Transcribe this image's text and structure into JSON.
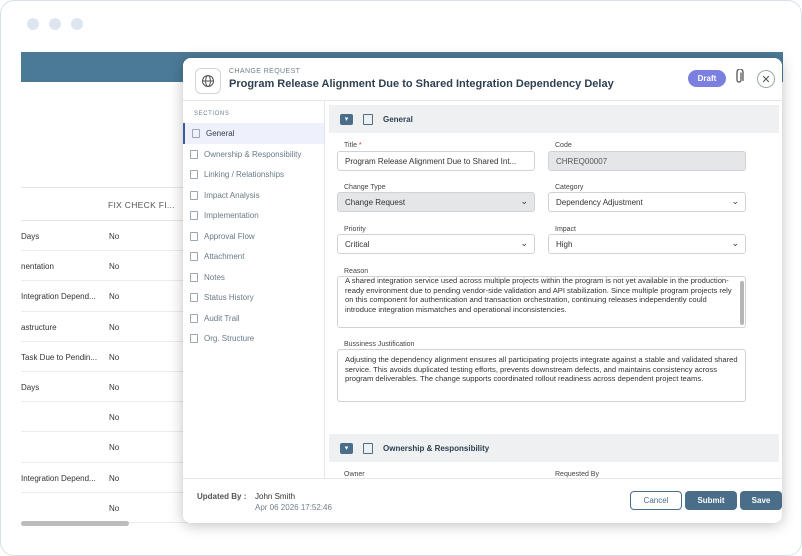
{
  "background_table": {
    "header": "FIX CHECK FI...",
    "rows": [
      {
        "name": "Days",
        "value": "No"
      },
      {
        "name": "nentation",
        "value": "No"
      },
      {
        "name": "Integration Depend...",
        "value": "No"
      },
      {
        "name": "astructure",
        "value": "No"
      },
      {
        "name": "Task Due to Pendin...",
        "value": "No"
      },
      {
        "name": "Days",
        "value": "No"
      },
      {
        "name": "",
        "value": "No"
      },
      {
        "name": "",
        "value": "No"
      },
      {
        "name": "Integration Depend...",
        "value": "No"
      },
      {
        "name": "",
        "value": "No"
      }
    ]
  },
  "modal": {
    "subtitle": "CHANGE REQUEST",
    "title": "Program Release Alignment Due to Shared Integration Dependency Delay",
    "status": "Draft",
    "close": "✕",
    "attach_icon": "paperclip-icon"
  },
  "sidebar": {
    "label": "SECTIONS",
    "items": [
      {
        "label": "General"
      },
      {
        "label": "Ownership & Responsibility"
      },
      {
        "label": "Linking / Relationships"
      },
      {
        "label": "Impact Analysis"
      },
      {
        "label": "Implementation"
      },
      {
        "label": "Approval Flow"
      },
      {
        "label": "Attachment"
      },
      {
        "label": "Notes"
      },
      {
        "label": "Status History"
      },
      {
        "label": "Audit Trail"
      },
      {
        "label": "Org. Structure"
      }
    ]
  },
  "general": {
    "heading": "General",
    "title_label": "Title",
    "title_required": "*",
    "title_value": "Program Release Alignment Due to Shared Int...",
    "code_label": "Code",
    "code_value": "CHREQ00007",
    "change_type_label": "Change Type",
    "change_type_value": "Change Request",
    "category_label": "Category",
    "category_value": "Dependency Adjustment",
    "priority_label": "Priority",
    "priority_value": "Critical",
    "impact_label": "Impact",
    "impact_value": "High",
    "reason_label": "Reason",
    "reason_value": "A shared integration service used across multiple projects within the program is not yet available in the production-ready environment due to pending vendor-side validation and API stabilization. Since multiple program projects rely on this component for authentication and transaction orchestration, continuing releases independently could introduce integration mismatches and operational inconsistencies.",
    "justification_label": "Bussiness Justification",
    "justification_value": "Adjusting the dependency alignment ensures all participating projects integrate against a stable and validated shared service. This avoids duplicated testing efforts, prevents downstream defects, and maintains consistency across program deliverables. The change supports coordinated rollout readiness across dependent project teams."
  },
  "ownership": {
    "heading": "Ownership & Responsibility",
    "owner_label": "Owner",
    "requested_by_label": "Requested By"
  },
  "footer": {
    "updated_by_label": "Updated By",
    "separator": ":",
    "updated_by_name": "John Smith",
    "updated_date": "Apr 06 2026 17:52:46",
    "cancel": "Cancel",
    "submit": "Submit",
    "save": "Save"
  },
  "colors": {
    "accent": "#4a6d8a",
    "draft_badge": "#7b7fe0"
  }
}
